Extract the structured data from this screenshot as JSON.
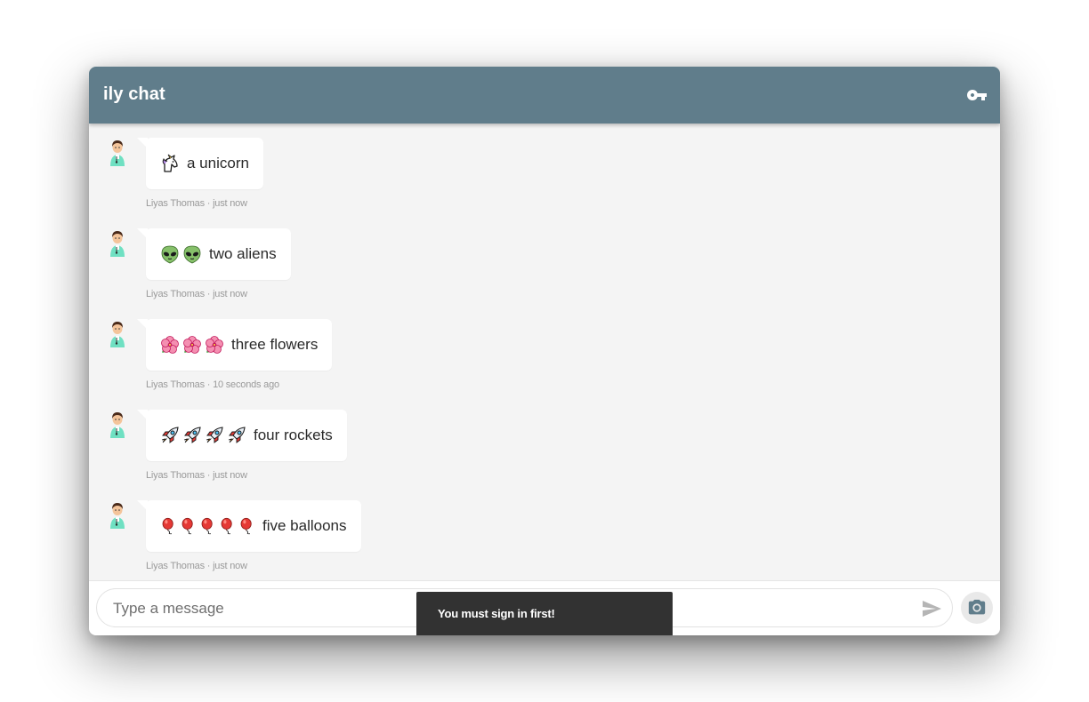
{
  "app": {
    "title": "ily chat",
    "accent_color": "#607d8b",
    "sign_in_icon": "key-icon"
  },
  "messages": [
    {
      "emoji": "unicorn",
      "emoji_count": 1,
      "text": "a unicorn",
      "author": "Liyas Thomas",
      "time": "just now"
    },
    {
      "emoji": "alien",
      "emoji_count": 2,
      "text": "two aliens",
      "author": "Liyas Thomas",
      "time": "just now"
    },
    {
      "emoji": "hibiscus",
      "emoji_count": 3,
      "text": "three flowers",
      "author": "Liyas Thomas",
      "time": "10 seconds ago"
    },
    {
      "emoji": "rocket",
      "emoji_count": 4,
      "text": "four rockets",
      "author": "Liyas Thomas",
      "time": "just now"
    },
    {
      "emoji": "balloon",
      "emoji_count": 5,
      "text": "five balloons",
      "author": "Liyas Thomas",
      "time": "just now"
    }
  ],
  "composer": {
    "placeholder": "Type a message",
    "value": "",
    "send_icon": "send-icon",
    "camera_icon": "camera-icon"
  },
  "snackbar": {
    "text": "You must sign in first!"
  }
}
